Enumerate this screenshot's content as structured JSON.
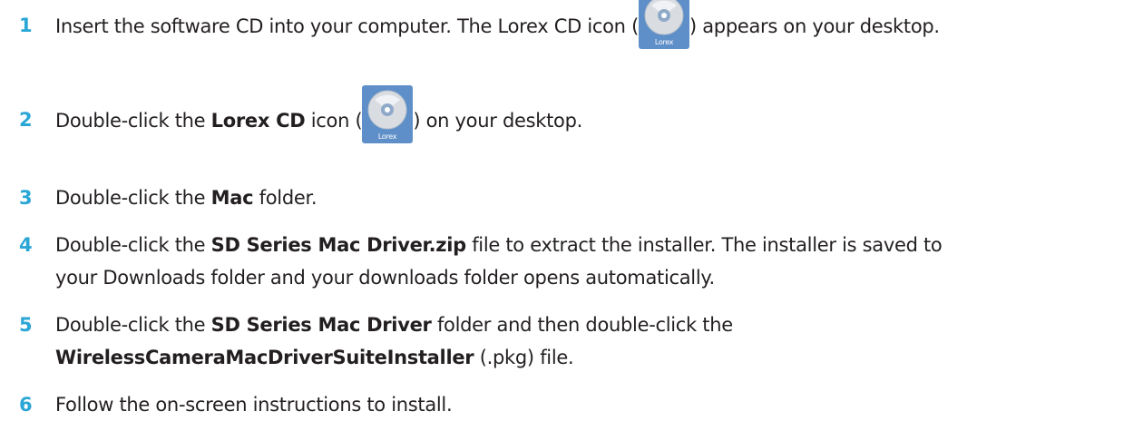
{
  "steps": [
    {
      "number": "1",
      "pre": "Insert the software CD into your computer. The Lorex CD icon (",
      "post": ") appears on your desktop."
    },
    {
      "number": "2",
      "pre": "Double-click the ",
      "bold": "Lorex CD",
      "mid": " icon (",
      "post": ") on your desktop."
    },
    {
      "number": "3",
      "pre": "Double-click the ",
      "bold": "Mac",
      "post": " folder."
    },
    {
      "number": "4",
      "pre": "Double-click the ",
      "bold": "SD Series Mac Driver.zip",
      "post": " file to extract the installer. The installer is saved to",
      "line2": "your Downloads folder and your downloads folder opens automatically."
    },
    {
      "number": "5",
      "pre": "Double-click the ",
      "bold": "SD Series Mac Driver",
      "post": " folder and then double-click the",
      "line2_bold": "WirelessCameraMacDriverSuiteInstaller",
      "line2_post": " (.pkg) file."
    },
    {
      "number": "6",
      "text": "Follow the on-screen instructions to install."
    }
  ],
  "icon": {
    "name": "lorex-cd-icon",
    "label": "Lorex",
    "color_bg": "#5f8fc8",
    "color_disc": "#d9dde2"
  },
  "colors": {
    "step_number": "#2aa6d6",
    "text": "#231f20"
  }
}
